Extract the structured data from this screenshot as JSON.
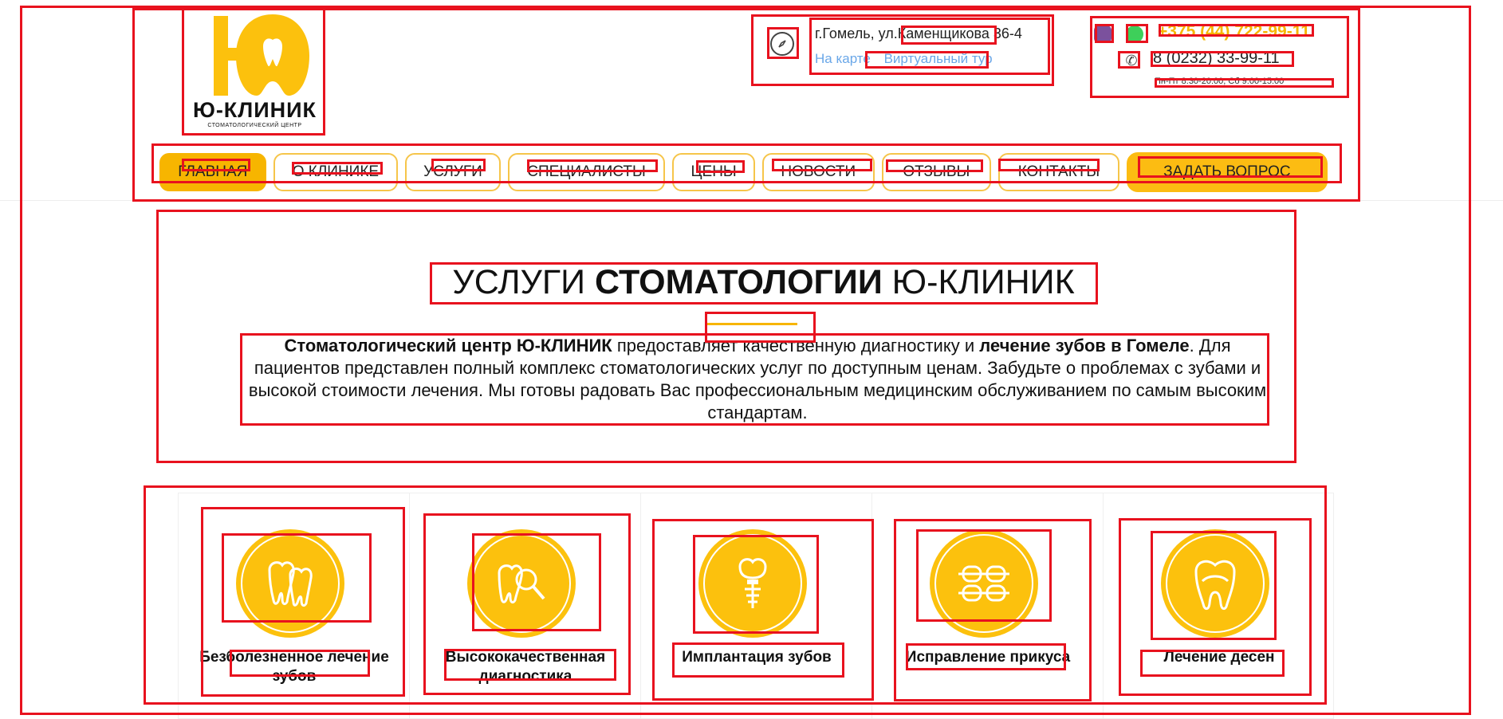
{
  "logo": {
    "letter": "Ю",
    "name": "Ю-КЛИНИК",
    "subtitle": "СТОМАТОЛОГИЧЕСКИЙ ЦЕНТР"
  },
  "contacts": {
    "address": "г.Гомель, ул.Каменщикова 36-4",
    "map_link": "На карте",
    "tour_link": "Виртуальный тур",
    "mobile_phone": "+375 (44) 722-99-11",
    "city_phone": "8 (0232) 33-99-11",
    "hours": "Пн-Пт 8:30-20:00, Сб 9:00-15:00"
  },
  "nav": {
    "items": [
      {
        "label": "Главная",
        "active": true
      },
      {
        "label": "О клинике",
        "active": false
      },
      {
        "label": "Услуги",
        "active": false
      },
      {
        "label": "Специалисты",
        "active": false
      },
      {
        "label": "Цены",
        "active": false
      },
      {
        "label": "Новости",
        "active": false
      },
      {
        "label": "Отзывы",
        "active": false
      },
      {
        "label": "Контакты",
        "active": false
      }
    ],
    "ask_button": "Задать вопрос"
  },
  "intro": {
    "title_part1": "УСЛУГИ ",
    "title_bold": "СТОМАТОЛОГИИ",
    "title_part2": " Ю-КЛИНИК",
    "text_bold1": "Стоматологический центр Ю-КЛИНИК",
    "text_mid": " предоставляет качественную диагностику и ",
    "text_bold2": "лечение зубов в Гомеле",
    "text_rest": ". Для пациентов представлен полный комплекс стоматологических услуг по доступным ценам. Забудьте о проблемах с зубами и высокой стоимости лечения. Мы готовы радовать Вас профессиональным медицинским обслуживанием по самым высоким стандартам."
  },
  "services": [
    {
      "label": "Безболезненное лечение зубов",
      "icon": "teeth-icon"
    },
    {
      "label": "Высококачественная диагностика",
      "icon": "diagnostic-magnifier-icon"
    },
    {
      "label": "Имплантация зубов",
      "icon": "implant-icon"
    },
    {
      "label": "Исправление прикуса",
      "icon": "braces-icon"
    },
    {
      "label": "Лечение десен",
      "icon": "gum-tooth-icon"
    }
  ],
  "colors": {
    "accent": "#fcc10d",
    "link": "#6aa7e8",
    "annotation": "#e8121e"
  }
}
